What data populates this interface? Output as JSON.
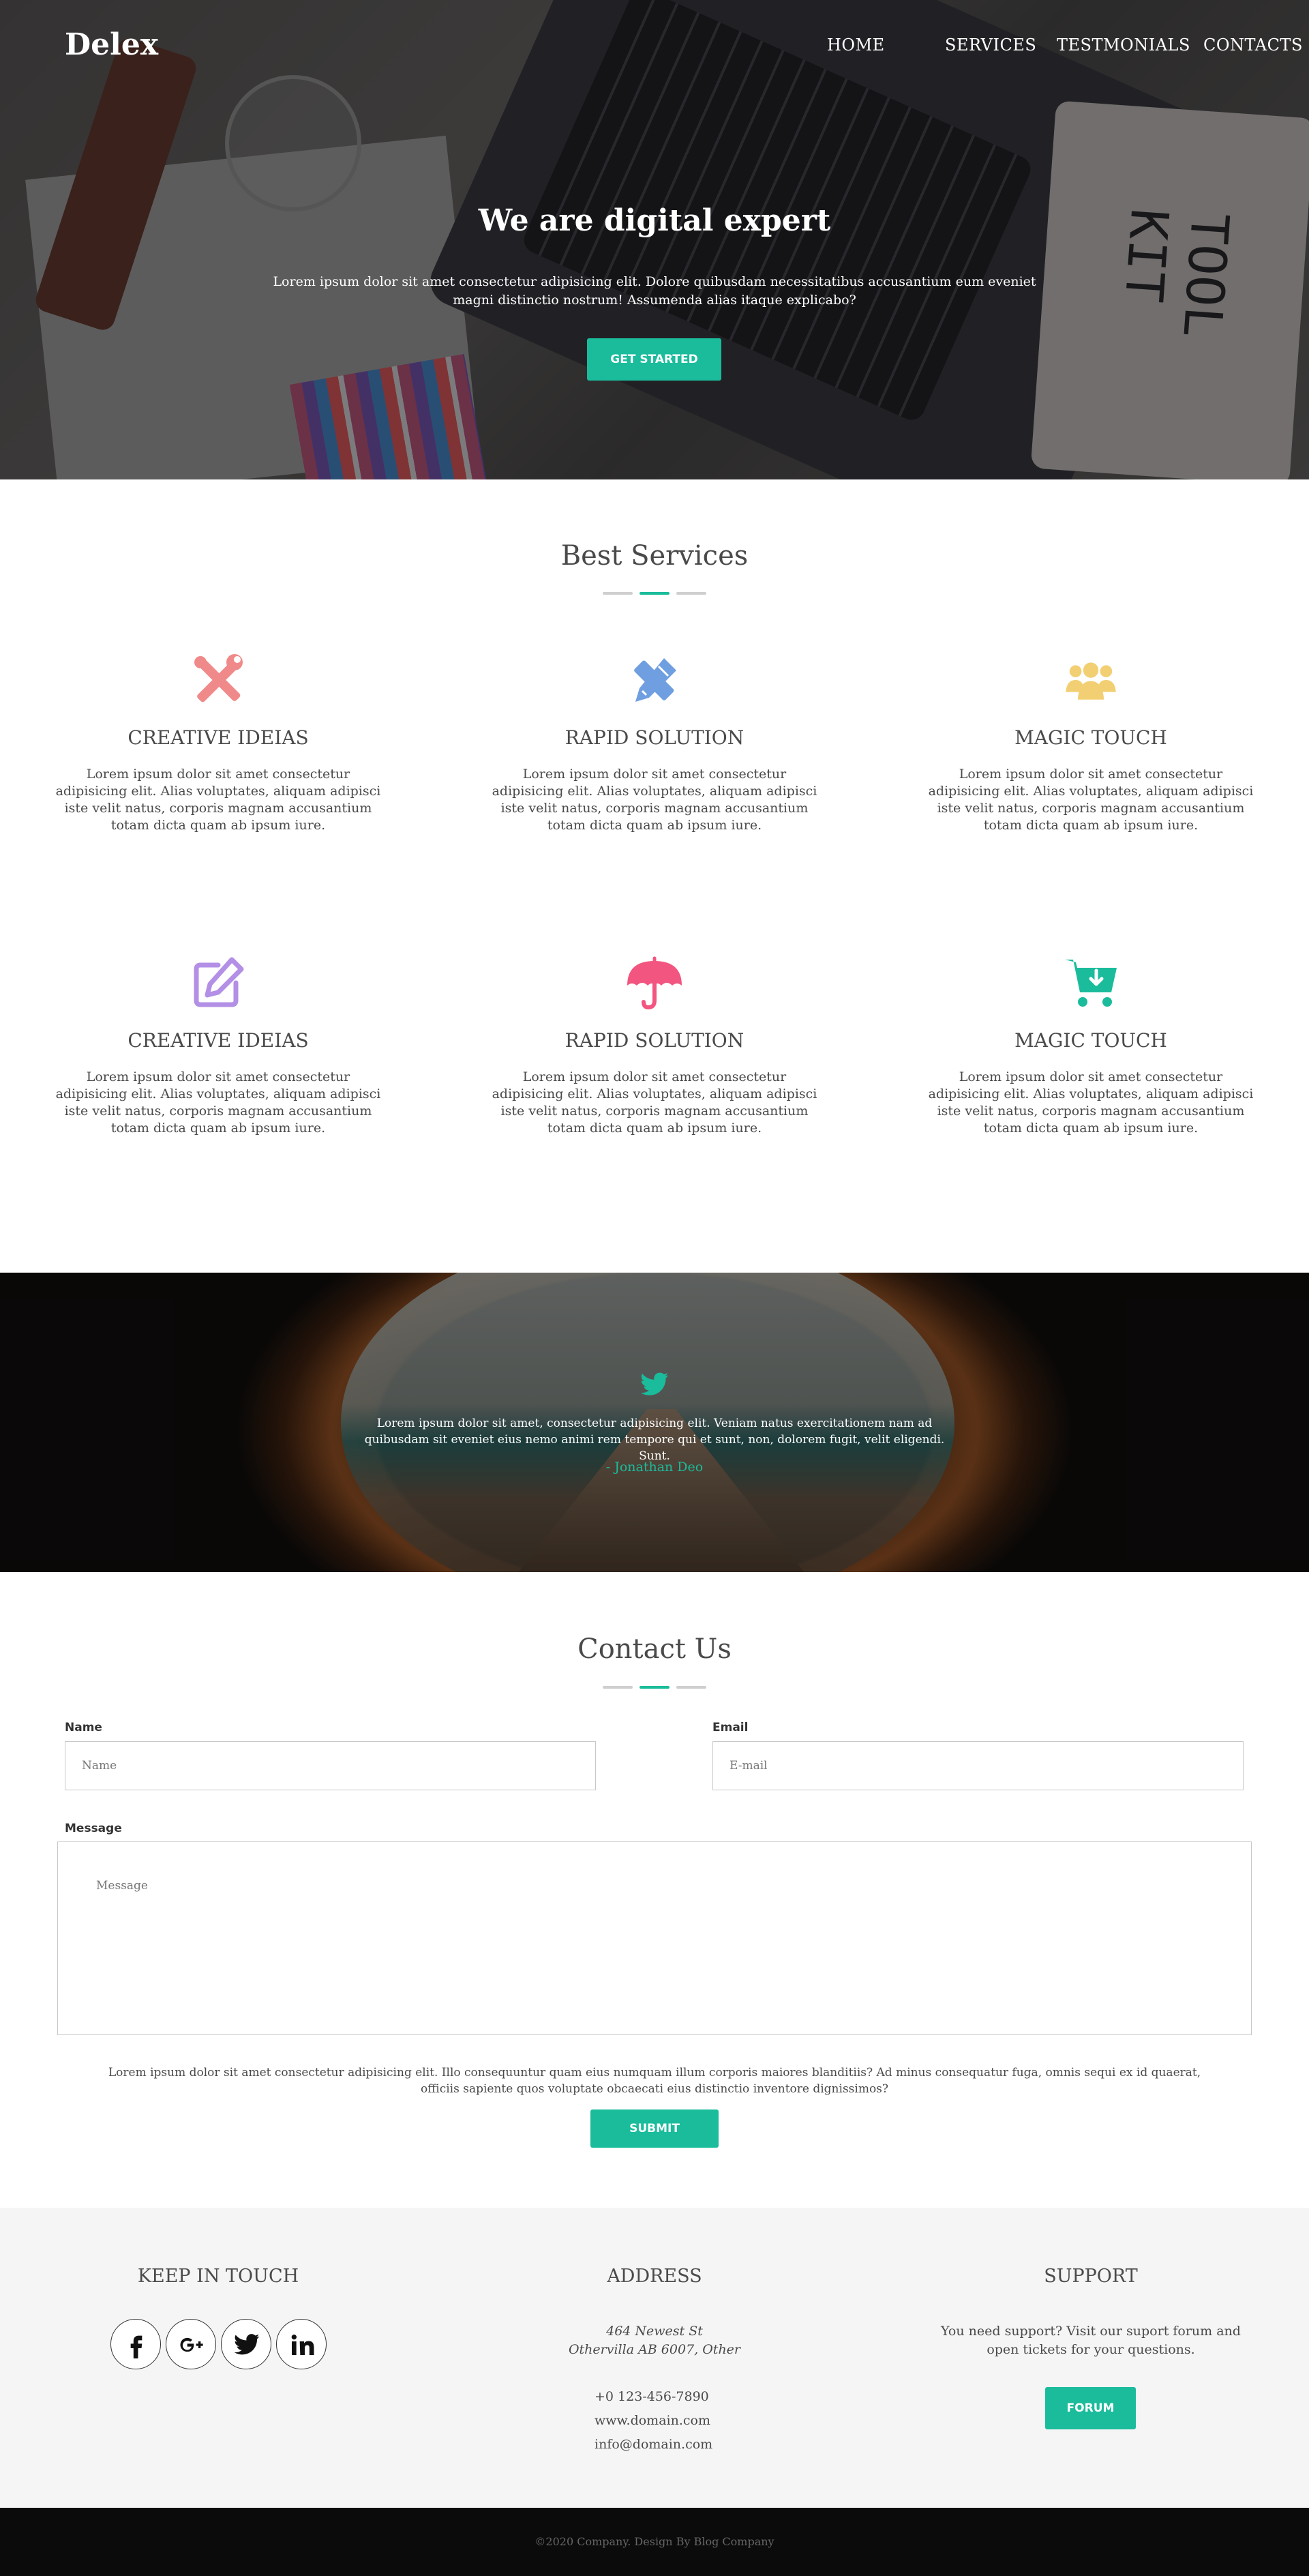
{
  "brand": {
    "logo": "Delex",
    "accent": "#1abc9c"
  },
  "nav": {
    "items": [
      "HOME",
      "SERVICES",
      "TESTMONIALS",
      "CONTACTS"
    ]
  },
  "hero": {
    "title": "We are digital expert",
    "text": "Lorem ipsum dolor sit amet consectetur adipisicing elit. Dolore quibusdam necessitatibus accusantium eum eveniet magni distinctio nostrum! Assumenda alias itaque explicabo?",
    "cta": "GET STARTED",
    "image_text": "TOOL KIT"
  },
  "services": {
    "title": "Best Services",
    "items": [
      {
        "icon": "tools-icon",
        "color": "#f08a8a",
        "title": "CREATIVE IDEIAS",
        "desc": "Lorem ipsum dolor sit amet consectetur adipisicing elit. Alias voluptates, aliquam adipisci iste velit natus, corporis magnam accusantium totam dicta quam ab ipsum iure."
      },
      {
        "icon": "pencil-ruler-icon",
        "color": "#6f9fe0",
        "title": "RAPID SOLUTION",
        "desc": "Lorem ipsum dolor sit amet consectetur adipisicing elit. Alias voluptates, aliquam adipisci iste velit natus, corporis magnam accusantium totam dicta quam ab ipsum iure."
      },
      {
        "icon": "users-icon",
        "color": "#f2cf72",
        "title": "MAGIC TOUCH",
        "desc": "Lorem ipsum dolor sit amet consectetur adipisicing elit. Alias voluptates, aliquam adipisci iste velit natus, corporis magnam accusantium totam dicta quam ab ipsum iure."
      },
      {
        "icon": "edit-icon",
        "color": "#b38fe6",
        "title": "CREATIVE IDEIAS",
        "desc": "Lorem ipsum dolor sit amet consectetur adipisicing elit. Alias voluptates, aliquam adipisci iste velit natus, corporis magnam accusantium totam dicta quam ab ipsum iure."
      },
      {
        "icon": "umbrella-icon",
        "color": "#f2557f",
        "title": "RAPID SOLUTION",
        "desc": "Lorem ipsum dolor sit amet consectetur adipisicing elit. Alias voluptates, aliquam adipisci iste velit natus, corporis magnam accusantium totam dicta quam ab ipsum iure."
      },
      {
        "icon": "cart-download-icon",
        "color": "#1abc9c",
        "title": "MAGIC TOUCH",
        "desc": "Lorem ipsum dolor sit amet consectetur adipisicing elit. Alias voluptates, aliquam adipisci iste velit natus, corporis magnam accusantium totam dicta quam ab ipsum iure."
      }
    ]
  },
  "testimonial": {
    "icon": "twitter-icon",
    "text": "Lorem ipsum dolor sit amet, consectetur adipisicing elit. Veniam natus exercitationem nam ad quibusdam sit eveniet eius nemo animi rem tempore qui et sunt, non, dolorem fugit, velit eligendi. Sunt.",
    "author": "- Jonathan Deo"
  },
  "contact": {
    "title": "Contact Us",
    "name_label": "Name",
    "name_placeholder": "Name",
    "email_label": "Email",
    "email_placeholder": "E-mail",
    "message_label": "Message",
    "message_placeholder": "Message",
    "note": "Lorem ipsum dolor sit amet consectetur adipisicing elit. Illo consequuntur quam eius numquam illum corporis maiores blanditiis? Ad minus consequatur fuga, omnis sequi ex id quaerat, officiis sapiente quos voluptate obcaecati eius distinctio inventore dignissimos?",
    "submit": "SUBMIT"
  },
  "footer": {
    "keep_title": "KEEP IN TOUCH",
    "social": [
      "facebook-icon",
      "google-plus-icon",
      "twitter-icon",
      "linkedin-icon"
    ],
    "address_title": "ADDRESS",
    "address_line1": "464 Newest St",
    "address_line2": "Othervilla AB 6007, Other",
    "phone": "+0 123-456-7890",
    "web": "www.domain.com",
    "email": "info@domain.com",
    "support_title": "SUPPORT",
    "support_text": "You need support? Visit our suport forum and open tickets for your questions.",
    "forum": "FORUM",
    "copyright": "©2020 Company. Design By Blog Company"
  }
}
